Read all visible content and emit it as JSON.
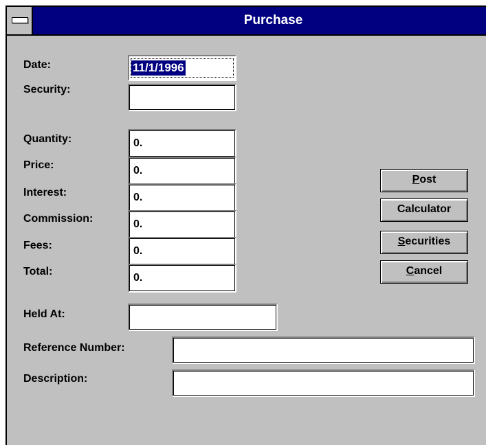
{
  "window": {
    "title": "Purchase"
  },
  "labels": {
    "date": "Date:",
    "security": "Security:",
    "quantity": "Quantity:",
    "price": "Price:",
    "interest": "Interest:",
    "commission": "Commission:",
    "fees": "Fees:",
    "total": "Total:",
    "held_at": "Held At:",
    "reference_number": "Reference Number:",
    "description": "Description:"
  },
  "fields": {
    "date": "11/1/1996",
    "security": "",
    "quantity": "0.",
    "price": "0.",
    "interest": "0.",
    "commission": "0.",
    "fees": "0.",
    "total": "0.",
    "held_at": "",
    "reference_number": "",
    "description": ""
  },
  "buttons": {
    "post": {
      "accel": "P",
      "rest": "ost"
    },
    "calculator": {
      "label": "Calculator"
    },
    "securities": {
      "accel": "S",
      "rest": "ecurities"
    },
    "cancel": {
      "accel": "C",
      "rest": "ancel"
    }
  },
  "colors": {
    "titlebar": "#000080",
    "dialog_face": "#c0c0c0",
    "selection": "#000080"
  },
  "icons": {
    "system_menu": "system-menu-icon"
  }
}
